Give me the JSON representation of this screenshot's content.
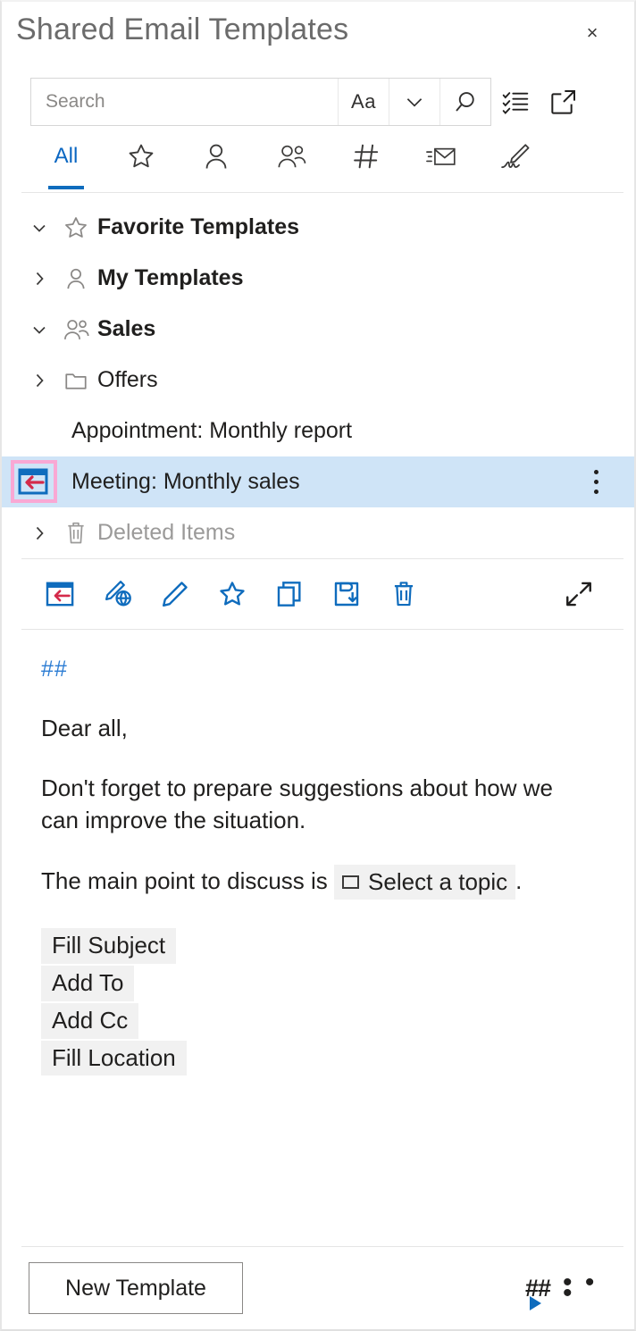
{
  "window": {
    "title": "Shared Email Templates",
    "close_label": "×"
  },
  "search": {
    "placeholder": "Search",
    "value": "",
    "match_case_label": "Aa",
    "buttons": [
      {
        "name": "match-case",
        "label": "Aa"
      },
      {
        "name": "search-options-chevron",
        "label": ""
      },
      {
        "name": "search-submit",
        "label": ""
      }
    ],
    "outer_icons": [
      {
        "name": "checklist-icon",
        "label": "Select templates"
      },
      {
        "name": "open-in-new-window-icon",
        "label": "Open in new window"
      }
    ]
  },
  "tabs": [
    {
      "label": "All",
      "icon": "all-text",
      "active": true
    },
    {
      "label": "",
      "icon": "star-icon",
      "active": false
    },
    {
      "label": "",
      "icon": "person-icon",
      "active": false
    },
    {
      "label": "",
      "icon": "people-icon",
      "active": false
    },
    {
      "label": "",
      "icon": "hash-icon",
      "active": false
    },
    {
      "label": "",
      "icon": "envelope-icon",
      "active": false
    },
    {
      "label": "",
      "icon": "signature-icon",
      "active": false
    }
  ],
  "tree": [
    {
      "label": "Favorite Templates",
      "icon": "star-icon",
      "chevron": "down",
      "bold": true,
      "muted": false,
      "kind": "folder",
      "indent": 0,
      "selected": false
    },
    {
      "label": "My Templates",
      "icon": "person-icon",
      "chevron": "right",
      "bold": true,
      "muted": false,
      "kind": "folder",
      "indent": 0,
      "selected": false
    },
    {
      "label": "Sales",
      "icon": "people-icon",
      "chevron": "down",
      "bold": true,
      "muted": false,
      "kind": "folder",
      "indent": 0,
      "selected": false
    },
    {
      "label": "Offers",
      "icon": "folder-icon",
      "chevron": "right",
      "bold": false,
      "muted": false,
      "kind": "folder",
      "indent": 0,
      "selected": false
    },
    {
      "label": "Appointment: Monthly report",
      "icon": "none",
      "chevron": "none",
      "bold": false,
      "muted": false,
      "kind": "template",
      "indent": 1,
      "selected": false
    },
    {
      "label": "Meeting: Monthly sales",
      "icon": "paste-template-icon",
      "chevron": "none",
      "bold": false,
      "muted": false,
      "kind": "template",
      "indent": 1,
      "selected": true,
      "highlighted_icon": true,
      "kebab": true
    },
    {
      "label": "Deleted Items",
      "icon": "trash-icon",
      "chevron": "right",
      "bold": false,
      "muted": true,
      "kind": "folder",
      "indent": 0,
      "selected": false
    }
  ],
  "actions": [
    {
      "name": "paste-template-icon",
      "label": "Paste template"
    },
    {
      "name": "edit-in-web-icon",
      "label": "Edit in web"
    },
    {
      "name": "edit-pencil-icon",
      "label": "Edit"
    },
    {
      "name": "favorite-star-icon",
      "label": "Add to favorites"
    },
    {
      "name": "copy-icon",
      "label": "Copy"
    },
    {
      "name": "save-icon",
      "label": "Save"
    },
    {
      "name": "delete-trash-icon",
      "label": "Delete"
    },
    {
      "name": "expand-icon",
      "label": "Expand"
    }
  ],
  "preview": {
    "hash_line": "##",
    "paragraphs": [
      "Dear all,",
      "Don't forget to prepare suggestions about how we can improve the situation."
    ],
    "sentence_prefix": "The main point to discuss is",
    "macro_label": "Select a topic",
    "sentence_suffix": ".",
    "chips": [
      "Fill Subject",
      "Add To",
      "Add Cc",
      "Fill Location"
    ]
  },
  "footer": {
    "new_template_label": "New Template",
    "macros_icon_label": "##",
    "more_label": "• • •"
  },
  "colors": {
    "accent": "#0f6cbd",
    "selection": "#cfe4f7",
    "highlight_box": "#f9a8d4",
    "reply_arrow": "#d42a4a",
    "chip_bg": "#f1f1f1",
    "muted_text": "#9b9a99"
  }
}
